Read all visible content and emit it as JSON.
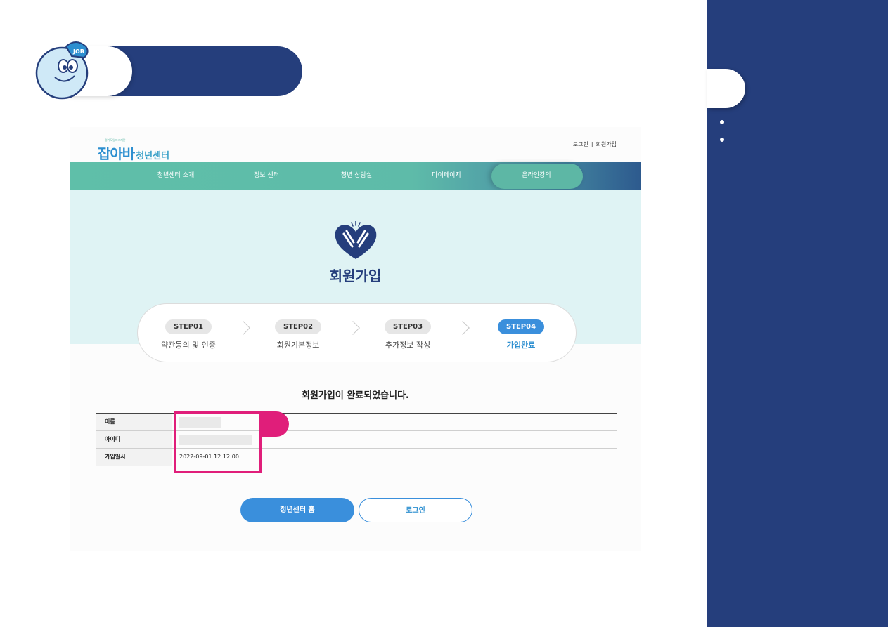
{
  "colors": {
    "navy": "#253e7c",
    "teal": "#5fbfa9",
    "blue": "#3a8fdc",
    "highlight": "#e01e7a",
    "hero_bg": "#dff3f4"
  },
  "mascot": {
    "icon": "job-mascot-icon",
    "cap_text": "JOB"
  },
  "site": {
    "logo_tagline": "경기도일자리재단",
    "logo_brand": "잡아바",
    "logo_sub": "청년센터",
    "top_links": {
      "login": "로그인",
      "separator": "|",
      "signup": "회원가입"
    }
  },
  "nav": {
    "items": [
      "청년센터 소개",
      "정보 센터",
      "청년 상담실",
      "마이페이지",
      "온라인강의"
    ]
  },
  "hero": {
    "icon": "clapping-hands-heart-icon",
    "title": "회원가입"
  },
  "steps": [
    {
      "badge": "STEP01",
      "label": "약관동의 및 인증",
      "active": false
    },
    {
      "badge": "STEP02",
      "label": "회원기본정보",
      "active": false
    },
    {
      "badge": "STEP03",
      "label": "추가정보 작성",
      "active": false
    },
    {
      "badge": "STEP04",
      "label": "가입완료",
      "active": true
    }
  ],
  "result": {
    "message": "회원가입이 완료되었습니다.",
    "rows": [
      {
        "label": "이름",
        "value": ""
      },
      {
        "label": "아이디",
        "value": ""
      },
      {
        "label": "가입일시",
        "value": "2022-09-01 12:12:00"
      }
    ]
  },
  "buttons": {
    "home": "청년센터 홈",
    "login": "로그인"
  }
}
